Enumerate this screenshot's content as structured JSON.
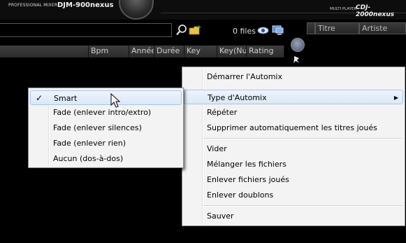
{
  "header": {
    "brand_left": "PROFESSIONAL MIXER",
    "mixer_model": "DJM-900nexus",
    "brand_right_small": "MULTI PLAYER",
    "player_model": "CDJ-2000nexus"
  },
  "browser": {
    "search_value": "",
    "files_count": "0 files",
    "columns": [
      "",
      "Bpm",
      "Année",
      "Durée",
      "Key",
      "Key(Num)",
      "Rating"
    ]
  },
  "right_panel": {
    "columns": [
      "",
      "Titre",
      "Artiste"
    ]
  },
  "context_menu": {
    "items": [
      "Démarrer l'Automix",
      "Type d'Automix",
      "Répéter",
      "Supprimer automatiquement les titres joués",
      "Vider",
      "Mélanger les fichiers",
      "Enlever fichiers joués",
      "Enlever doublons",
      "Sauver"
    ],
    "submenu_arrow": "▶"
  },
  "automix_submenu": {
    "checkmark": "✓",
    "selected_index": 0,
    "items": [
      "Smart",
      "Fade (enlever intro/extro)",
      "Fade (enlever silences)",
      "Fade (enlever rien)",
      "Aucun (dos-à-dos)"
    ]
  },
  "colors": {
    "background": "#000000",
    "menu_bg": "#f3f3f3",
    "highlight": "#dbe8f6",
    "highlight_border": "#a9c6e8"
  }
}
